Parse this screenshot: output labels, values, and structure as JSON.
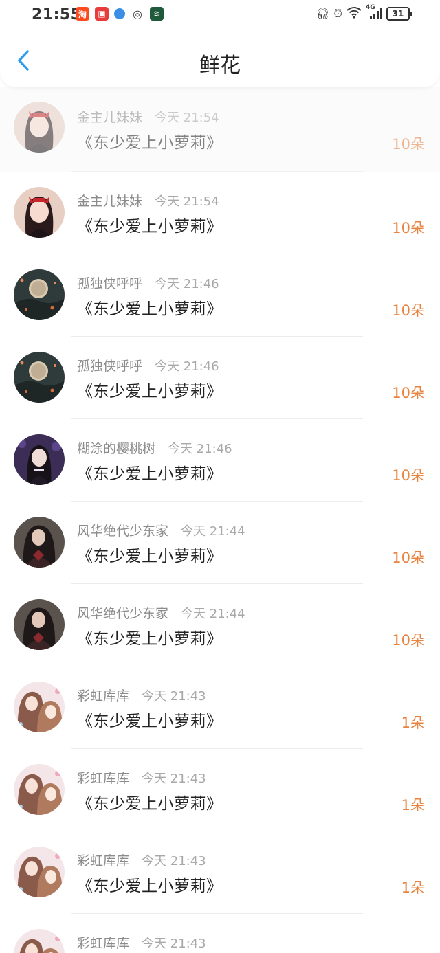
{
  "status_bar": {
    "time": "21:55",
    "app_icons": [
      {
        "name": "taobao-icon",
        "glyph": "淘",
        "color": "#ff4a1f"
      },
      {
        "name": "red-app-icon",
        "glyph": "▣",
        "color": "#e83b3b"
      },
      {
        "name": "browser-icon",
        "glyph": "●",
        "color": "#3a8ee6"
      },
      {
        "name": "wechat-icon",
        "glyph": "◎",
        "color": "#444444"
      },
      {
        "name": "green-app-icon",
        "glyph": "≋",
        "color": "#1f5a3c"
      }
    ],
    "network": "4G",
    "battery": "31"
  },
  "header": {
    "back_icon": "chevron-left-icon",
    "title": "鲜花"
  },
  "colors": {
    "accent_blue": "#2a9bf0",
    "flower_orange": "#e8843f"
  },
  "records": [
    {
      "user": "金主儿妹妹",
      "time": "今天 21:54",
      "book": "《东少爱上小萝莉》",
      "amount": "10朵",
      "avatar": "avatar-girl-red-bow"
    },
    {
      "user": "金主儿妹妹",
      "time": "今天 21:54",
      "book": "《东少爱上小萝莉》",
      "amount": "10朵",
      "avatar": "avatar-girl-red-bow"
    },
    {
      "user": "孤独侠呼呼",
      "time": "今天 21:46",
      "book": "《东少爱上小萝莉》",
      "amount": "10朵",
      "avatar": "avatar-moon-tree"
    },
    {
      "user": "孤独侠呼呼",
      "time": "今天 21:46",
      "book": "《东少爱上小萝莉》",
      "amount": "10朵",
      "avatar": "avatar-moon-tree"
    },
    {
      "user": "糊涂的樱桃树",
      "time": "今天 21:46",
      "book": "《东少爱上小萝莉》",
      "amount": "10朵",
      "avatar": "avatar-purple-girl"
    },
    {
      "user": "风华绝代少东家",
      "time": "今天 21:44",
      "book": "《东少爱上小萝莉》",
      "amount": "10朵",
      "avatar": "avatar-warrior-woman"
    },
    {
      "user": "风华绝代少东家",
      "time": "今天 21:44",
      "book": "《东少爱上小萝莉》",
      "amount": "10朵",
      "avatar": "avatar-warrior-woman"
    },
    {
      "user": "彩虹库库",
      "time": "今天 21:43",
      "book": "《东少爱上小萝莉》",
      "amount": "1朵",
      "avatar": "avatar-pastel-girls"
    },
    {
      "user": "彩虹库库",
      "time": "今天 21:43",
      "book": "《东少爱上小萝莉》",
      "amount": "1朵",
      "avatar": "avatar-pastel-girls"
    },
    {
      "user": "彩虹库库",
      "time": "今天 21:43",
      "book": "《东少爱上小萝莉》",
      "amount": "1朵",
      "avatar": "avatar-pastel-girls"
    },
    {
      "user": "彩虹库库",
      "time": "今天 21:43",
      "book": "",
      "amount": "",
      "avatar": "avatar-pastel-girls"
    }
  ]
}
